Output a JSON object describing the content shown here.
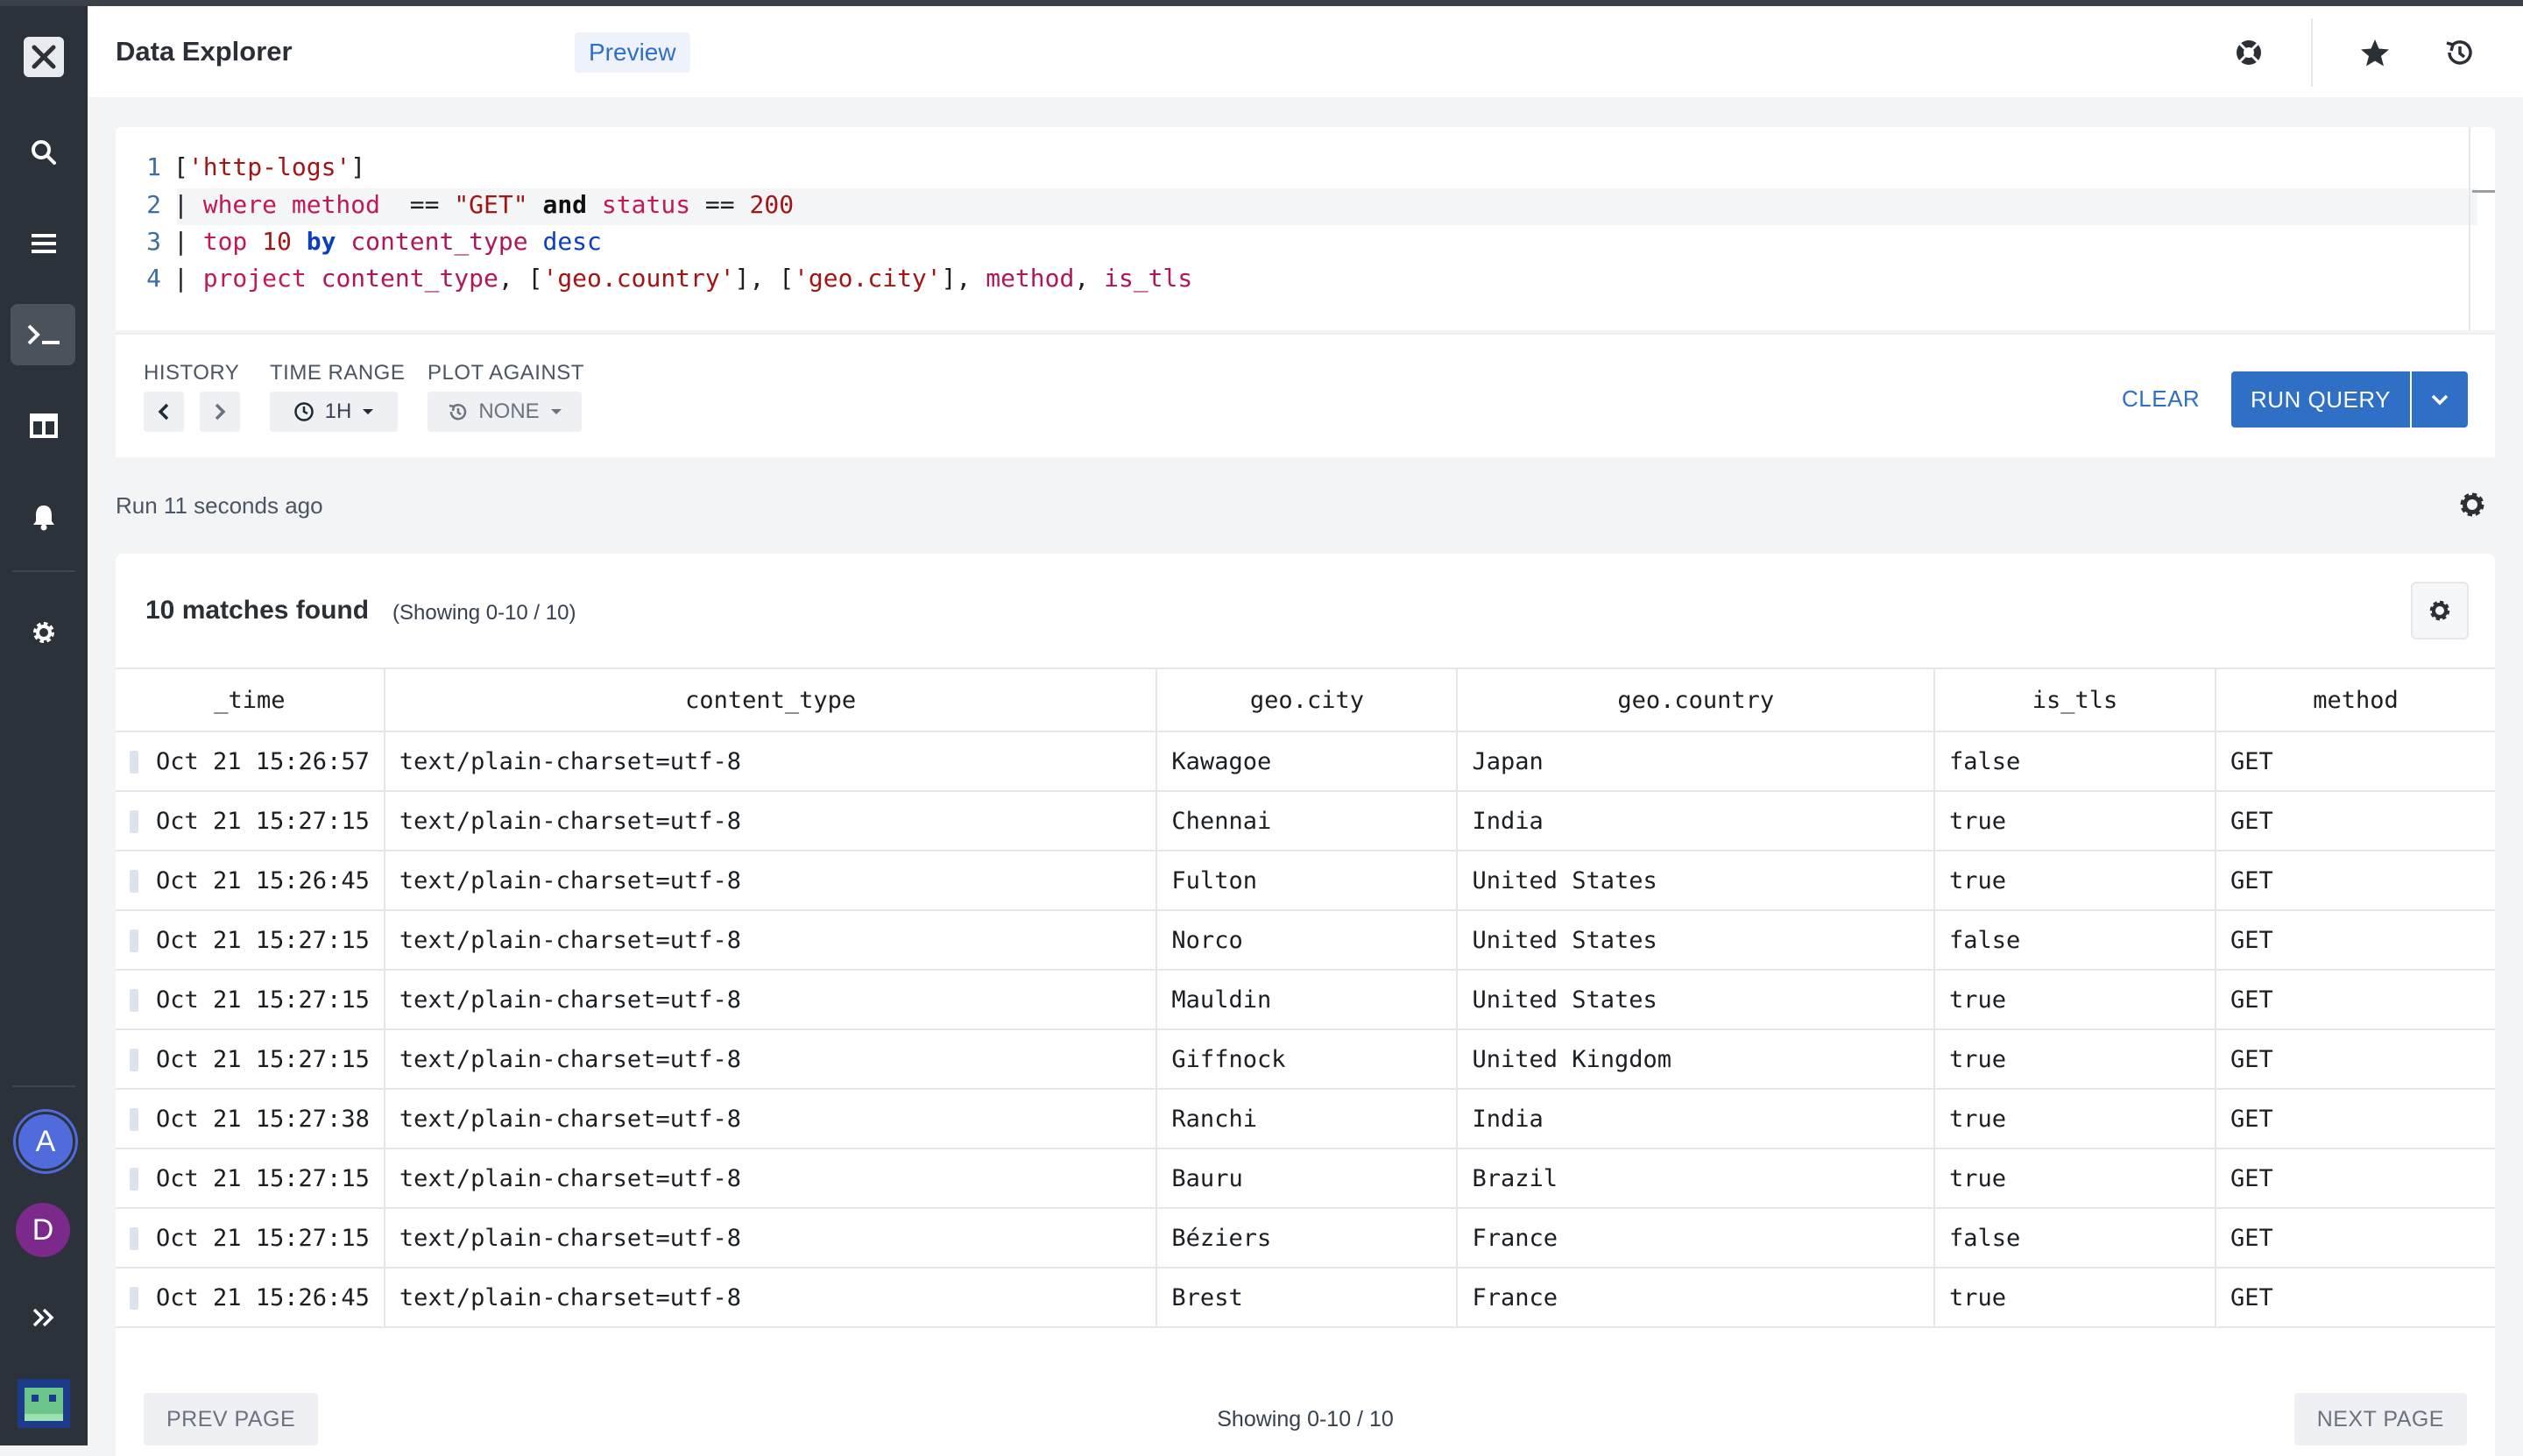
{
  "app": {
    "title": "Data Explorer",
    "badge": "Preview"
  },
  "query": {
    "lines": [
      [
        "1"
      ],
      [
        "2"
      ],
      [
        "3"
      ],
      [
        "4"
      ]
    ]
  },
  "controls": {
    "history_label": "HISTORY",
    "time_range_label": "TIME RANGE",
    "time_range_value": "1H",
    "plot_against_label": "PLOT AGAINST",
    "plot_against_value": "NONE",
    "clear_label": "CLEAR",
    "run_label": "RUN QUERY"
  },
  "status": {
    "run_ago": "Run 11 seconds ago"
  },
  "results": {
    "matches": "10 matches found",
    "showing": "(Showing 0-10 / 10)",
    "columns": [
      "_time",
      "content_type",
      "geo.city",
      "geo.country",
      "is_tls",
      "method"
    ],
    "rows": [
      [
        "Oct 21 15:26:57",
        "text/plain-charset=utf-8",
        "Kawagoe",
        "Japan",
        "false",
        "GET"
      ],
      [
        "Oct 21 15:27:15",
        "text/plain-charset=utf-8",
        "Chennai",
        "India",
        "true",
        "GET"
      ],
      [
        "Oct 21 15:26:45",
        "text/plain-charset=utf-8",
        "Fulton",
        "United States",
        "true",
        "GET"
      ],
      [
        "Oct 21 15:27:15",
        "text/plain-charset=utf-8",
        "Norco",
        "United States",
        "false",
        "GET"
      ],
      [
        "Oct 21 15:27:15",
        "text/plain-charset=utf-8",
        "Mauldin",
        "United States",
        "true",
        "GET"
      ],
      [
        "Oct 21 15:27:15",
        "text/plain-charset=utf-8",
        "Giffnock",
        "United Kingdom",
        "true",
        "GET"
      ],
      [
        "Oct 21 15:27:38",
        "text/plain-charset=utf-8",
        "Ranchi",
        "India",
        "true",
        "GET"
      ],
      [
        "Oct 21 15:27:15",
        "text/plain-charset=utf-8",
        "Bauru",
        "Brazil",
        "true",
        "GET"
      ],
      [
        "Oct 21 15:27:15",
        "text/plain-charset=utf-8",
        "Béziers",
        "France",
        "false",
        "GET"
      ],
      [
        "Oct 21 15:26:45",
        "text/plain-charset=utf-8",
        "Brest",
        "France",
        "true",
        "GET"
      ]
    ],
    "prev_label": "PREV PAGE",
    "next_label": "NEXT PAGE",
    "showing_bottom": "Showing 0-10 / 10"
  },
  "sidebar": {
    "avatar_a": "A",
    "avatar_d": "D",
    "icons": [
      "close-icon",
      "search-icon",
      "menu-icon",
      "terminal-icon",
      "table-icon",
      "bell-icon",
      "gear-icon",
      "expand-icon",
      "app-logo"
    ]
  },
  "colors": {
    "accent": "#2f6fc6",
    "sidebar": "#2c323a"
  }
}
